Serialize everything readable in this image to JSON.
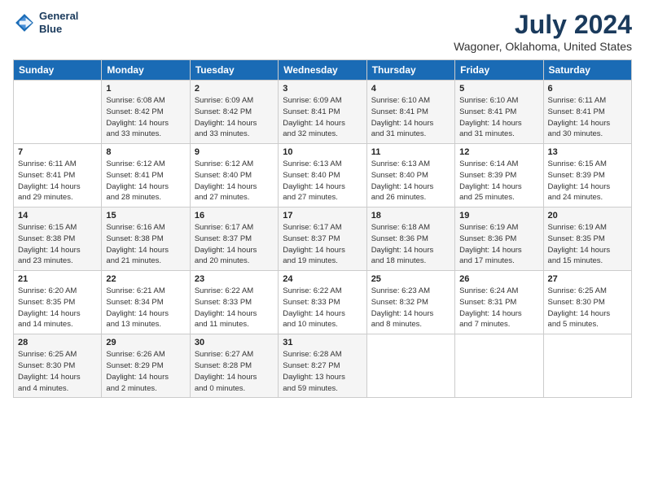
{
  "logo": {
    "line1": "General",
    "line2": "Blue"
  },
  "title": "July 2024",
  "subtitle": "Wagoner, Oklahoma, United States",
  "header_days": [
    "Sunday",
    "Monday",
    "Tuesday",
    "Wednesday",
    "Thursday",
    "Friday",
    "Saturday"
  ],
  "weeks": [
    [
      {
        "day": "",
        "info": ""
      },
      {
        "day": "1",
        "info": "Sunrise: 6:08 AM\nSunset: 8:42 PM\nDaylight: 14 hours\nand 33 minutes."
      },
      {
        "day": "2",
        "info": "Sunrise: 6:09 AM\nSunset: 8:42 PM\nDaylight: 14 hours\nand 33 minutes."
      },
      {
        "day": "3",
        "info": "Sunrise: 6:09 AM\nSunset: 8:41 PM\nDaylight: 14 hours\nand 32 minutes."
      },
      {
        "day": "4",
        "info": "Sunrise: 6:10 AM\nSunset: 8:41 PM\nDaylight: 14 hours\nand 31 minutes."
      },
      {
        "day": "5",
        "info": "Sunrise: 6:10 AM\nSunset: 8:41 PM\nDaylight: 14 hours\nand 31 minutes."
      },
      {
        "day": "6",
        "info": "Sunrise: 6:11 AM\nSunset: 8:41 PM\nDaylight: 14 hours\nand 30 minutes."
      }
    ],
    [
      {
        "day": "7",
        "info": "Sunrise: 6:11 AM\nSunset: 8:41 PM\nDaylight: 14 hours\nand 29 minutes."
      },
      {
        "day": "8",
        "info": "Sunrise: 6:12 AM\nSunset: 8:41 PM\nDaylight: 14 hours\nand 28 minutes."
      },
      {
        "day": "9",
        "info": "Sunrise: 6:12 AM\nSunset: 8:40 PM\nDaylight: 14 hours\nand 27 minutes."
      },
      {
        "day": "10",
        "info": "Sunrise: 6:13 AM\nSunset: 8:40 PM\nDaylight: 14 hours\nand 27 minutes."
      },
      {
        "day": "11",
        "info": "Sunrise: 6:13 AM\nSunset: 8:40 PM\nDaylight: 14 hours\nand 26 minutes."
      },
      {
        "day": "12",
        "info": "Sunrise: 6:14 AM\nSunset: 8:39 PM\nDaylight: 14 hours\nand 25 minutes."
      },
      {
        "day": "13",
        "info": "Sunrise: 6:15 AM\nSunset: 8:39 PM\nDaylight: 14 hours\nand 24 minutes."
      }
    ],
    [
      {
        "day": "14",
        "info": "Sunrise: 6:15 AM\nSunset: 8:38 PM\nDaylight: 14 hours\nand 23 minutes."
      },
      {
        "day": "15",
        "info": "Sunrise: 6:16 AM\nSunset: 8:38 PM\nDaylight: 14 hours\nand 21 minutes."
      },
      {
        "day": "16",
        "info": "Sunrise: 6:17 AM\nSunset: 8:37 PM\nDaylight: 14 hours\nand 20 minutes."
      },
      {
        "day": "17",
        "info": "Sunrise: 6:17 AM\nSunset: 8:37 PM\nDaylight: 14 hours\nand 19 minutes."
      },
      {
        "day": "18",
        "info": "Sunrise: 6:18 AM\nSunset: 8:36 PM\nDaylight: 14 hours\nand 18 minutes."
      },
      {
        "day": "19",
        "info": "Sunrise: 6:19 AM\nSunset: 8:36 PM\nDaylight: 14 hours\nand 17 minutes."
      },
      {
        "day": "20",
        "info": "Sunrise: 6:19 AM\nSunset: 8:35 PM\nDaylight: 14 hours\nand 15 minutes."
      }
    ],
    [
      {
        "day": "21",
        "info": "Sunrise: 6:20 AM\nSunset: 8:35 PM\nDaylight: 14 hours\nand 14 minutes."
      },
      {
        "day": "22",
        "info": "Sunrise: 6:21 AM\nSunset: 8:34 PM\nDaylight: 14 hours\nand 13 minutes."
      },
      {
        "day": "23",
        "info": "Sunrise: 6:22 AM\nSunset: 8:33 PM\nDaylight: 14 hours\nand 11 minutes."
      },
      {
        "day": "24",
        "info": "Sunrise: 6:22 AM\nSunset: 8:33 PM\nDaylight: 14 hours\nand 10 minutes."
      },
      {
        "day": "25",
        "info": "Sunrise: 6:23 AM\nSunset: 8:32 PM\nDaylight: 14 hours\nand 8 minutes."
      },
      {
        "day": "26",
        "info": "Sunrise: 6:24 AM\nSunset: 8:31 PM\nDaylight: 14 hours\nand 7 minutes."
      },
      {
        "day": "27",
        "info": "Sunrise: 6:25 AM\nSunset: 8:30 PM\nDaylight: 14 hours\nand 5 minutes."
      }
    ],
    [
      {
        "day": "28",
        "info": "Sunrise: 6:25 AM\nSunset: 8:30 PM\nDaylight: 14 hours\nand 4 minutes."
      },
      {
        "day": "29",
        "info": "Sunrise: 6:26 AM\nSunset: 8:29 PM\nDaylight: 14 hours\nand 2 minutes."
      },
      {
        "day": "30",
        "info": "Sunrise: 6:27 AM\nSunset: 8:28 PM\nDaylight: 14 hours\nand 0 minutes."
      },
      {
        "day": "31",
        "info": "Sunrise: 6:28 AM\nSunset: 8:27 PM\nDaylight: 13 hours\nand 59 minutes."
      },
      {
        "day": "",
        "info": ""
      },
      {
        "day": "",
        "info": ""
      },
      {
        "day": "",
        "info": ""
      }
    ]
  ],
  "colors": {
    "header_bg": "#1a6bb5",
    "header_text": "#ffffff",
    "title_color": "#1a3a5c",
    "odd_row": "#f5f5f5",
    "even_row": "#ffffff"
  }
}
